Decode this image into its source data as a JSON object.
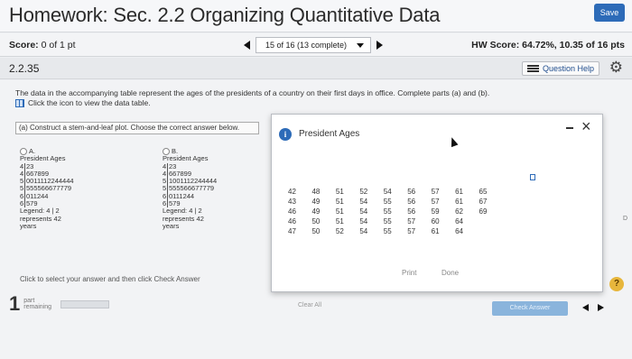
{
  "header": {
    "title": "Homework: Sec. 2.2 Organizing Quantitative Data",
    "save_label": "Save"
  },
  "score_bar": {
    "score_label": "Score:",
    "score_value": "0 of 1 pt",
    "pager_text": "15 of 16 (13 complete)",
    "hw_score": "HW Score: 64.72%, 10.35 of 16 pts"
  },
  "question": {
    "number": "2.2.35",
    "help_label": "Question Help",
    "prompt": "The data in the accompanying table represent the ages of the presidents of a country on their first days in office. Complete parts (a) and (b).",
    "table_link": "Click the icon to view the data table.",
    "part_a": "(a) Construct a stem-and-leaf plot. Choose the correct answer below.",
    "click_note": "Click to select your answer and then click Check Answer"
  },
  "options": [
    {
      "letter": "A.",
      "title": "President Ages",
      "rows": [
        {
          "stem": "4",
          "leaves": "23"
        },
        {
          "stem": "4",
          "leaves": "667899"
        },
        {
          "stem": "5",
          "leaves": "0011112244444"
        },
        {
          "stem": "5",
          "leaves": "555566677779"
        },
        {
          "stem": "6",
          "leaves": "011244"
        },
        {
          "stem": "6",
          "leaves": "579"
        }
      ],
      "legend_1": "Legend: 4 | 2",
      "legend_2": "represents 42",
      "legend_3": "years"
    },
    {
      "letter": "B.",
      "title": "President Ages",
      "rows": [
        {
          "stem": "4",
          "leaves": "23"
        },
        {
          "stem": "4",
          "leaves": "667899"
        },
        {
          "stem": "5",
          "leaves": "1001112244444"
        },
        {
          "stem": "5",
          "leaves": "555566677779"
        },
        {
          "stem": "6",
          "leaves": "0111244"
        },
        {
          "stem": "6",
          "leaves": "579"
        }
      ],
      "legend_1": "Legend: 4 | 2",
      "legend_2": "represents 42",
      "legend_3": "years"
    }
  ],
  "footer": {
    "remaining_count": "1",
    "remaining_label_1": "part",
    "remaining_label_2": "remaining",
    "progress_fraction": 0.0,
    "clear_all": "Clear All",
    "check_answer": "Check Answer",
    "help_symbol": "?",
    "right_edge_letter": "D"
  },
  "popup": {
    "info_symbol": "i",
    "title": "President Ages",
    "close_symbol": "×",
    "rows": [
      [
        "42",
        "48",
        "51",
        "52",
        "54",
        "56",
        "57",
        "61",
        "65"
      ],
      [
        "43",
        "49",
        "51",
        "54",
        "55",
        "56",
        "57",
        "61",
        "67"
      ],
      [
        "46",
        "49",
        "51",
        "54",
        "55",
        "56",
        "59",
        "62",
        "69"
      ],
      [
        "46",
        "50",
        "51",
        "54",
        "55",
        "57",
        "60",
        "64",
        ""
      ],
      [
        "47",
        "50",
        "52",
        "54",
        "55",
        "57",
        "61",
        "64",
        ""
      ]
    ],
    "print_label": "Print",
    "done_label": "Done"
  },
  "colors": {
    "save_blue": "#2d6bb8",
    "check_answer_disabled": "#8ab4dc",
    "help_yellow": "#e7b63c"
  }
}
